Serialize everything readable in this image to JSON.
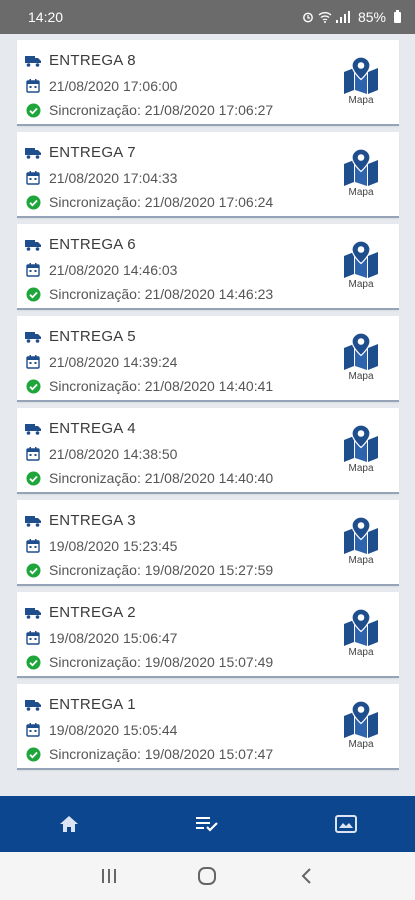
{
  "status_bar": {
    "time": "14:20",
    "battery": "85%"
  },
  "deliveries": [
    {
      "title": "ENTREGA 8",
      "date": "21/08/2020 17:06:00",
      "sync": "Sincronização: 21/08/2020 17:06:27",
      "map_label": "Mapa"
    },
    {
      "title": "ENTREGA 7",
      "date": "21/08/2020 17:04:33",
      "sync": "Sincronização: 21/08/2020 17:06:24",
      "map_label": "Mapa"
    },
    {
      "title": "ENTREGA 6",
      "date": "21/08/2020 14:46:03",
      "sync": "Sincronização: 21/08/2020 14:46:23",
      "map_label": "Mapa"
    },
    {
      "title": "ENTREGA 5",
      "date": "21/08/2020 14:39:24",
      "sync": "Sincronização: 21/08/2020 14:40:41",
      "map_label": "Mapa"
    },
    {
      "title": "ENTREGA 4",
      "date": "21/08/2020 14:38:50",
      "sync": "Sincronização: 21/08/2020 14:40:40",
      "map_label": "Mapa"
    },
    {
      "title": "ENTREGA 3",
      "date": "19/08/2020 15:23:45",
      "sync": "Sincronização: 19/08/2020 15:27:59",
      "map_label": "Mapa"
    },
    {
      "title": "ENTREGA 2",
      "date": "19/08/2020 15:06:47",
      "sync": "Sincronização: 19/08/2020 15:07:49",
      "map_label": "Mapa"
    },
    {
      "title": "ENTREGA 1",
      "date": "19/08/2020 15:05:44",
      "sync": "Sincronização: 19/08/2020 15:07:47",
      "map_label": "Mapa"
    }
  ],
  "icons": {
    "title_icon": "truck-icon",
    "date_icon": "calendar-icon",
    "sync_icon": "check-circle-icon",
    "map_icon": "map-pin-icon"
  },
  "bottom_nav": [
    {
      "name": "home",
      "icon": "home-icon"
    },
    {
      "name": "deliveries",
      "icon": "list-check-icon",
      "active": true
    },
    {
      "name": "gallery",
      "icon": "image-icon"
    }
  ],
  "colors": {
    "primary": "#0b468f",
    "icon_blue": "#1f4e8c",
    "success": "#1ea63a",
    "status_bar": "#6b6b6b"
  }
}
